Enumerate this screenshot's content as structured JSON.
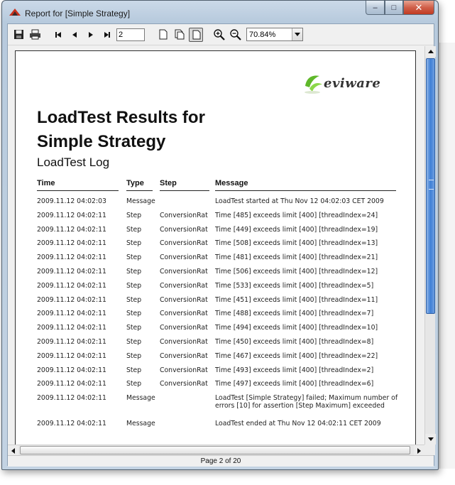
{
  "window": {
    "title": "Report for [Simple Strategy]",
    "minimize_glyph": "–",
    "maximize_glyph": "□",
    "close_glyph": "✕"
  },
  "toolbar": {
    "page_value": "2",
    "zoom_value": "70.84%"
  },
  "report": {
    "logo_text": "eviware",
    "title": "LoadTest Results for Simple Strategy",
    "subtitle": "LoadTest Log",
    "columns": {
      "time": "Time",
      "type": "Type",
      "step": "Step",
      "message": "Message"
    },
    "rows": [
      {
        "time": "2009.11.12 04:02:03",
        "type": "Message",
        "step": "",
        "message": "LoadTest started at Thu Nov 12 04:02:03 CET 2009"
      },
      {
        "time": "2009.11.12 04:02:11",
        "type": "Step",
        "step": "ConversionRat",
        "message": "Time [485] exceeds limit [400] [threadIndex=24]"
      },
      {
        "time": "2009.11.12 04:02:11",
        "type": "Step",
        "step": "ConversionRat",
        "message": "Time [449] exceeds limit [400] [threadIndex=19]"
      },
      {
        "time": "2009.11.12 04:02:11",
        "type": "Step",
        "step": "ConversionRat",
        "message": "Time [508] exceeds limit [400] [threadIndex=13]"
      },
      {
        "time": "2009.11.12 04:02:11",
        "type": "Step",
        "step": "ConversionRat",
        "message": "Time [481] exceeds limit [400] [threadIndex=21]"
      },
      {
        "time": "2009.11.12 04:02:11",
        "type": "Step",
        "step": "ConversionRat",
        "message": "Time [506] exceeds limit [400] [threadIndex=12]"
      },
      {
        "time": "2009.11.12 04:02:11",
        "type": "Step",
        "step": "ConversionRat",
        "message": "Time [533] exceeds limit [400] [threadIndex=5]"
      },
      {
        "time": "2009.11.12 04:02:11",
        "type": "Step",
        "step": "ConversionRat",
        "message": "Time [451] exceeds limit [400] [threadIndex=11]"
      },
      {
        "time": "2009.11.12 04:02:11",
        "type": "Step",
        "step": "ConversionRat",
        "message": "Time [488] exceeds limit [400] [threadIndex=7]"
      },
      {
        "time": "2009.11.12 04:02:11",
        "type": "Step",
        "step": "ConversionRat",
        "message": "Time [494] exceeds limit [400] [threadIndex=10]"
      },
      {
        "time": "2009.11.12 04:02:11",
        "type": "Step",
        "step": "ConversionRat",
        "message": "Time [450] exceeds limit [400] [threadIndex=8]"
      },
      {
        "time": "2009.11.12 04:02:11",
        "type": "Step",
        "step": "ConversionRat",
        "message": "Time [467] exceeds limit [400] [threadIndex=22]"
      },
      {
        "time": "2009.11.12 04:02:11",
        "type": "Step",
        "step": "ConversionRat",
        "message": "Time [493] exceeds limit [400] [threadIndex=2]"
      },
      {
        "time": "2009.11.12 04:02:11",
        "type": "Step",
        "step": "ConversionRat",
        "message": "Time [497] exceeds limit [400] [threadIndex=6]"
      },
      {
        "time": "2009.11.12 04:02:11",
        "type": "Message",
        "step": "",
        "message": "LoadTest [Simple Strategy] failed; Maximum number of errors [10] for assertion [Step Maximum] exceeded"
      },
      {
        "time": "2009.11.12 04:02:11",
        "type": "Message",
        "step": "",
        "message": "LoadTest ended at Thu Nov 12 04:02:11 CET 2009"
      }
    ]
  },
  "status": {
    "page_indicator": "Page 2 of 20"
  },
  "colors": {
    "scroll_thumb": "#3e7fd6",
    "logo_green": "#5fb82a",
    "title_bar": "#c3d3e3"
  },
  "icons": [
    "app-icon",
    "save-icon",
    "print-icon",
    "first-page-icon",
    "prev-page-icon",
    "next-page-icon",
    "last-page-icon",
    "single-page-icon",
    "facing-pages-icon",
    "continuous-pages-icon",
    "zoom-in-icon",
    "zoom-out-icon",
    "chevron-down-icon",
    "scroll-up-icon",
    "scroll-down-icon",
    "scroll-left-icon",
    "scroll-right-icon"
  ]
}
